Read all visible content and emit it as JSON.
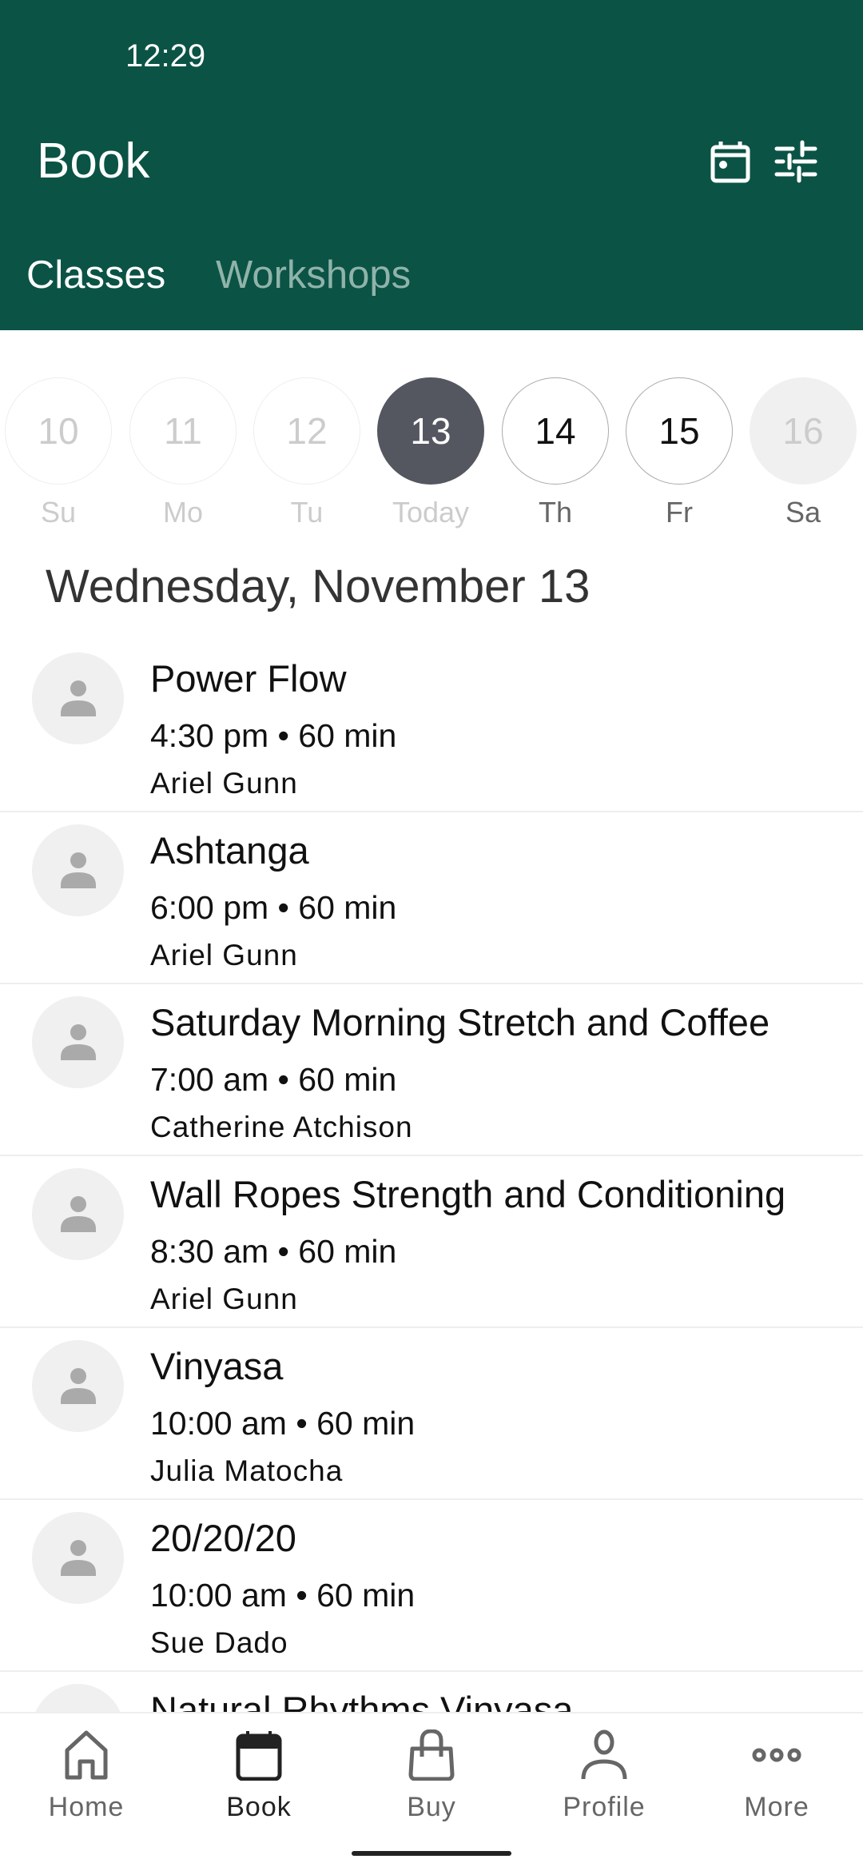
{
  "status": {
    "time": "12:29"
  },
  "header": {
    "title": "Book",
    "icons": [
      "calendar-icon",
      "filter-sliders-icon"
    ],
    "color": "#0b5345"
  },
  "tabs": [
    {
      "label": "Classes",
      "active": true
    },
    {
      "label": "Workshops",
      "active": false
    }
  ],
  "dates": [
    {
      "num": "10",
      "label": "Su",
      "state": "past"
    },
    {
      "num": "11",
      "label": "Mo",
      "state": "past"
    },
    {
      "num": "12",
      "label": "Tu",
      "state": "past"
    },
    {
      "num": "13",
      "label": "Today",
      "state": "selected"
    },
    {
      "num": "14",
      "label": "Th",
      "state": "future"
    },
    {
      "num": "15",
      "label": "Fr",
      "state": "future"
    },
    {
      "num": "16",
      "label": "Sa",
      "state": "disabled"
    }
  ],
  "date_heading": "Wednesday, November 13",
  "classes": [
    {
      "title": "Power Flow",
      "meta": "4:30 pm • 60 min",
      "instructor": "Ariel Gunn"
    },
    {
      "title": "Ashtanga",
      "meta": "6:00 pm • 60 min",
      "instructor": "Ariel Gunn"
    },
    {
      "title": "Saturday Morning Stretch and Coffee",
      "meta": "7:00 am • 60 min",
      "instructor": "Catherine Atchison"
    },
    {
      "title": "Wall Ropes Strength and Conditioning",
      "meta": "8:30 am • 60 min",
      "instructor": "Ariel Gunn"
    },
    {
      "title": "Vinyasa",
      "meta": "10:00 am • 60 min",
      "instructor": "Julia Matocha"
    },
    {
      "title": "20/20/20",
      "meta": "10:00 am • 60 min",
      "instructor": "Sue Dado"
    },
    {
      "title": "Natural Rhythms Vinyasa",
      "meta": "",
      "instructor": ""
    }
  ],
  "nav": [
    {
      "label": "Home"
    },
    {
      "label": "Book",
      "active": true
    },
    {
      "label": "Buy"
    },
    {
      "label": "Profile"
    },
    {
      "label": "More"
    }
  ]
}
